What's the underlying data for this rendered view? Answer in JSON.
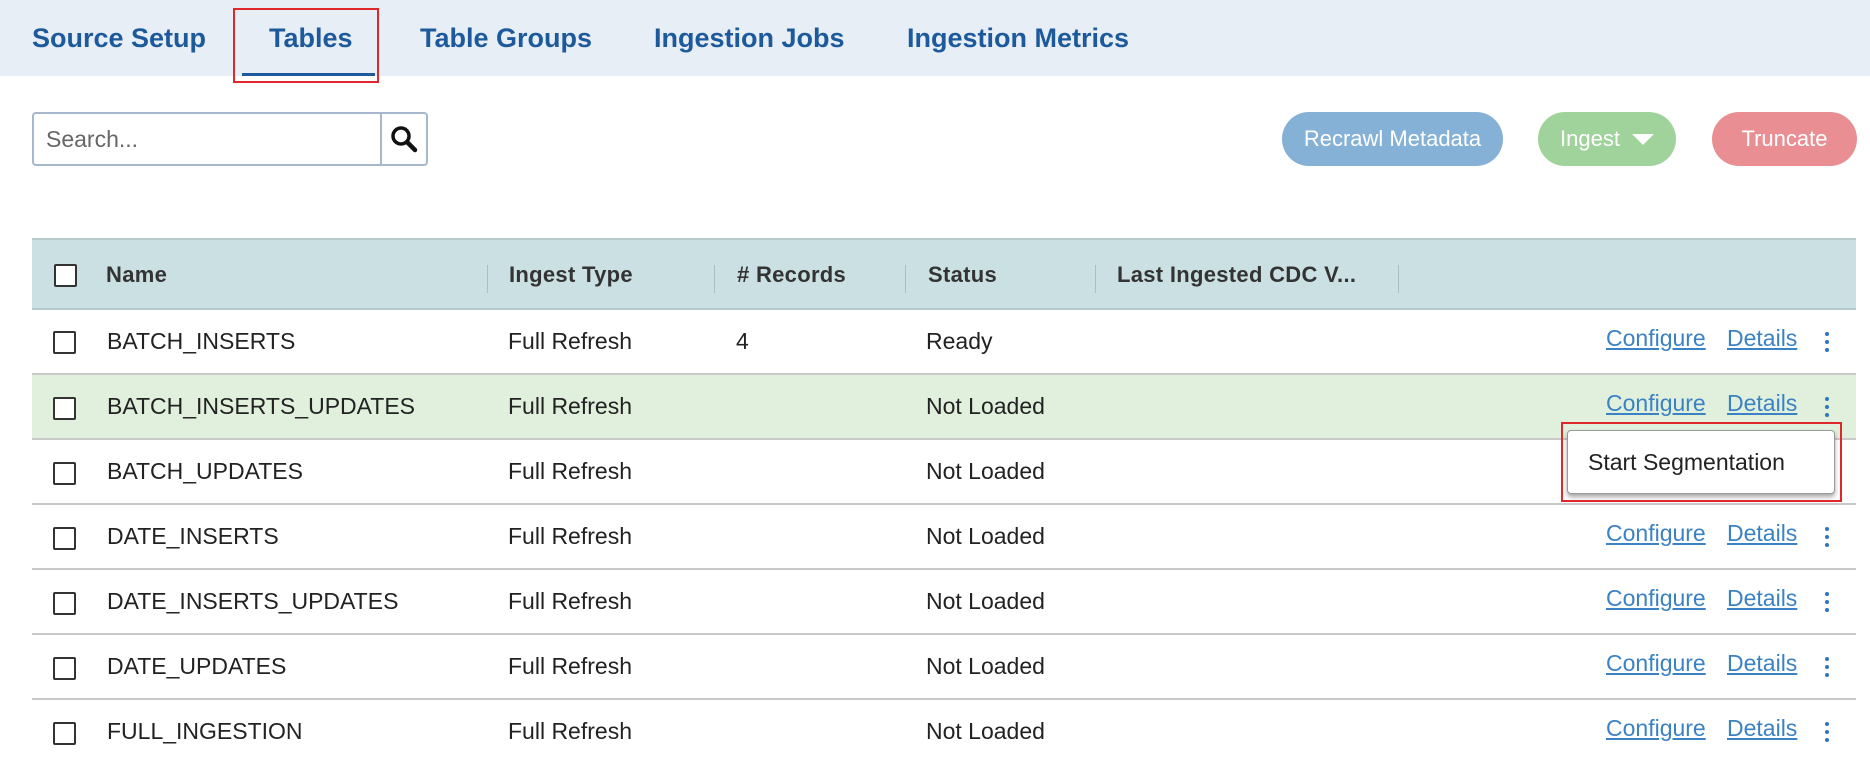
{
  "tabs": [
    {
      "label": "Source Setup",
      "active": false
    },
    {
      "label": "Tables",
      "active": true
    },
    {
      "label": "Table Groups",
      "active": false
    },
    {
      "label": "Ingestion Jobs",
      "active": false
    },
    {
      "label": "Ingestion Metrics",
      "active": false
    }
  ],
  "search": {
    "placeholder": "Search...",
    "value": ""
  },
  "toolbar": {
    "recrawl_label": "Recrawl Metadata",
    "ingest_label": "Ingest",
    "truncate_label": "Truncate"
  },
  "table": {
    "columns": [
      "Name",
      "Ingest Type",
      "# Records",
      "Status",
      "Last Ingested CDC V..."
    ],
    "rows": [
      {
        "name": "BATCH_INSERTS",
        "ingest_type": "Full Refresh",
        "records": "4",
        "status": "Ready"
      },
      {
        "name": "BATCH_INSERTS_UPDATES",
        "ingest_type": "Full Refresh",
        "records": "",
        "status": "Not Loaded"
      },
      {
        "name": "BATCH_UPDATES",
        "ingest_type": "Full Refresh",
        "records": "",
        "status": "Not Loaded"
      },
      {
        "name": "DATE_INSERTS",
        "ingest_type": "Full Refresh",
        "records": "",
        "status": "Not Loaded"
      },
      {
        "name": "DATE_INSERTS_UPDATES",
        "ingest_type": "Full Refresh",
        "records": "",
        "status": "Not Loaded"
      },
      {
        "name": "DATE_UPDATES",
        "ingest_type": "Full Refresh",
        "records": "",
        "status": "Not Loaded"
      },
      {
        "name": "FULL_INGESTION",
        "ingest_type": "Full Refresh",
        "records": "",
        "status": "Not Loaded"
      }
    ],
    "configure_label": "Configure",
    "details_label": "Details"
  },
  "context_menu": {
    "items": [
      "Start Segmentation"
    ]
  },
  "colors": {
    "tab_text": "#1d5a9c",
    "highlight_box": "#e0272b",
    "highlight_row": "#e0f0dc",
    "link": "#3b82c4"
  }
}
